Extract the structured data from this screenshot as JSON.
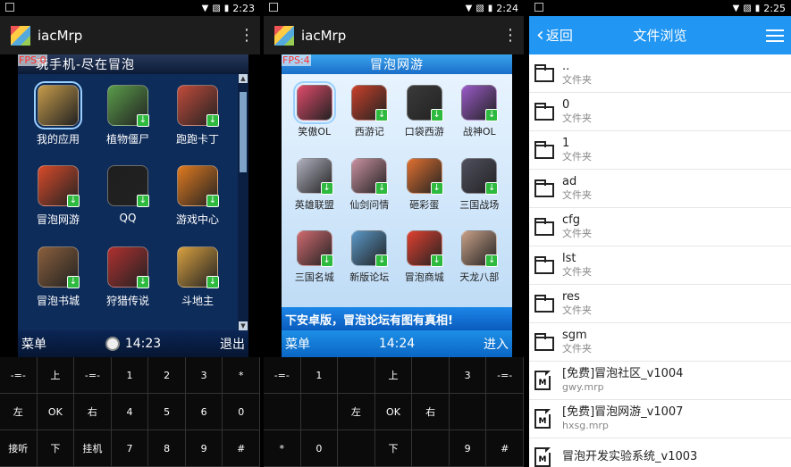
{
  "phone1": {
    "time": "2:23",
    "app_title": "iacMrp",
    "fps": "FPS:0",
    "screen_title": "玩手机-尽在冒泡",
    "apps": [
      {
        "label": "我的应用",
        "color": "#c69b4a",
        "selected": true
      },
      {
        "label": "植物僵尸",
        "color": "#5a9c4a"
      },
      {
        "label": "跑跑卡丁",
        "color": "#c24b3b"
      },
      {
        "label": "冒泡网游",
        "color": "#d84a2a"
      },
      {
        "label": "QQ",
        "color": "#1e1e1e"
      },
      {
        "label": "游戏中心",
        "color": "#e07a20"
      },
      {
        "label": "冒泡书城",
        "color": "#8a5f3c"
      },
      {
        "label": "狩猎传说",
        "color": "#b03030"
      },
      {
        "label": "斗地主",
        "color": "#d8a040"
      }
    ],
    "softbar": {
      "left": "菜单",
      "time": "14:23",
      "right": "退出"
    },
    "keys": [
      "-=-",
      "上",
      "-=-",
      "1",
      "2",
      "3",
      "*",
      "左",
      "OK",
      "右",
      "4",
      "5",
      "6",
      "0",
      "接听",
      "下",
      "挂机",
      "7",
      "8",
      "9",
      "#"
    ]
  },
  "phone2": {
    "time": "2:24",
    "app_title": "iacMrp",
    "fps": "FPS:4",
    "screen_title": "冒泡网游",
    "apps": [
      {
        "label": "笑傲OL",
        "color": "#e04a6a",
        "selected": true
      },
      {
        "label": "西游记",
        "color": "#c8402a"
      },
      {
        "label": "口袋西游",
        "color": "#3a3a3a"
      },
      {
        "label": "战神OL",
        "color": "#9a5ac8"
      },
      {
        "label": "英雄联盟",
        "color": "#b0b0c0"
      },
      {
        "label": "仙剑问情",
        "color": "#c890a0"
      },
      {
        "label": "砸彩蛋",
        "color": "#e07030"
      },
      {
        "label": "三国战场",
        "color": "#505060"
      },
      {
        "label": "三国名城",
        "color": "#d06a70"
      },
      {
        "label": "新版论坛",
        "color": "#5a98c8"
      },
      {
        "label": "冒泡商城",
        "color": "#e04030"
      },
      {
        "label": "天龙八部",
        "color": "#c8a088"
      }
    ],
    "banner": "下安卓版，冒泡论坛有图有真相!",
    "softbar": {
      "left": "菜单",
      "time": "14:24",
      "right": "进入"
    },
    "keys": [
      "-=-",
      "1",
      "",
      "上",
      "",
      "3",
      "-=-",
      "",
      "",
      "左",
      "OK",
      "右",
      "",
      "",
      "*",
      "0",
      "",
      "下",
      "",
      "9",
      "#"
    ]
  },
  "phone3": {
    "time": "2:25",
    "back_label": "返回",
    "title": "文件浏览",
    "entries": [
      {
        "name": "..",
        "sub": "文件夹",
        "type": "folder"
      },
      {
        "name": "0",
        "sub": "文件夹",
        "type": "folder"
      },
      {
        "name": "1",
        "sub": "文件夹",
        "type": "folder"
      },
      {
        "name": "ad",
        "sub": "文件夹",
        "type": "folder"
      },
      {
        "name": "cfg",
        "sub": "文件夹",
        "type": "folder"
      },
      {
        "name": "lst",
        "sub": "文件夹",
        "type": "folder"
      },
      {
        "name": "res",
        "sub": "文件夹",
        "type": "folder"
      },
      {
        "name": "sgm",
        "sub": "文件夹",
        "type": "folder"
      },
      {
        "name": "[免费]冒泡社区_v1004",
        "sub": "gwy.mrp",
        "type": "mrp"
      },
      {
        "name": "[免费]冒泡网游_v1007",
        "sub": "hxsg.mrp",
        "type": "mrp"
      },
      {
        "name": "冒泡开发实验系统_v1003",
        "sub": "",
        "type": "mrp"
      }
    ]
  }
}
